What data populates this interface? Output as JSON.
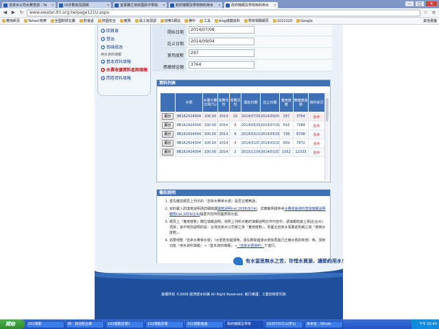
{
  "browser": {
    "tabs": [
      {
        "label": "自來水公司水費查詢 - Ya",
        "active": false
      },
      {
        "label": "ID計數資訊調網",
        "active": false
      },
      {
        "label": "宜賓職立嶺安國民中學綜",
        "active": false
      },
      {
        "label": "欽府端關及學校節約用水",
        "active": false
      },
      {
        "label": "政府機關及學校節約用水",
        "active": true
      }
    ],
    "address": "www.ewater.itri.org.tw/page121U.aspx",
    "bookmarks": [
      "應用新頁",
      "Yahoo!奇摩",
      "全國財研在職",
      "財會處",
      "校園安全",
      "教務",
      "員工資源調",
      "快樂1網站",
      "佛中",
      "工具",
      "blog總體資料",
      "學校相關網頁",
      "1021220",
      "Google"
    ],
    "bookmarks_other": "其他書籤"
  },
  "leftnav": {
    "items": [
      {
        "label": "回首頁",
        "emphasis": false
      },
      {
        "label": "登出",
        "emphasis": false
      },
      {
        "label": "密碼修改",
        "emphasis": false
      }
    ],
    "group_label": "用水資料填報",
    "sub_items": [
      {
        "label": "基本資料填報",
        "emphasis": false
      },
      {
        "label": "水費收據資料查詢填報",
        "emphasis": true
      },
      {
        "label": "問卷資料填報",
        "emphasis": false
      }
    ]
  },
  "form": {
    "rows": [
      {
        "label": "開始日期",
        "value": "2014/07/08"
      },
      {
        "label": "訖止日期",
        "value": "2014/09/04"
      },
      {
        "label": "實用度數",
        "value": "297"
      },
      {
        "label": "應繳總金額",
        "value": "3764"
      }
    ]
  },
  "list": {
    "title": "資料列表",
    "headers": [
      "",
      "水號",
      "水量分攤比例(%)",
      "收費年份",
      "收費月份",
      "開始日期",
      "訖止日期",
      "實用度數",
      "應繳總金額",
      "資料狀況"
    ],
    "button_label": "顯示",
    "rows": [
      {
        "water_no": "8B162424004",
        "ratio": "100.00",
        "year": "2014",
        "month": "10",
        "start": "2014/07/08",
        "end": "2014/09/04",
        "usage": "297",
        "amount": "3764",
        "status": "台水",
        "style": "selected"
      },
      {
        "water_no": "8B162424004",
        "ratio": "100.00",
        "year": "2014",
        "month": "8",
        "start": "2014/05/08",
        "end": "2014/07/08",
        "usage": "616",
        "amount": "7384",
        "status": "台水",
        "style": "odd"
      },
      {
        "water_no": "8B162424004",
        "ratio": "100.00",
        "year": "2014",
        "month": "6",
        "start": "2014/03/10",
        "end": "2014/05/08",
        "usage": "736",
        "amount": "8748",
        "status": "台水",
        "style": "even"
      },
      {
        "water_no": "8B162424004",
        "ratio": "100.00",
        "year": "2014",
        "month": "4",
        "start": "2014/01/07",
        "end": "2014/03/10",
        "usage": "659",
        "amount": "7872",
        "status": "台水",
        "style": "odd"
      },
      {
        "water_no": "8B162424004",
        "ratio": "100.00",
        "year": "2014",
        "month": "2",
        "start": "2013/11/06",
        "end": "2014/01/07",
        "usage": "1052",
        "amount": "12333",
        "status": "台水",
        "style": "even"
      }
    ]
  },
  "notes": {
    "title": "備註說明",
    "items": [
      {
        "text": "首先確認網頁上列示的『自來水費單水號』是否正確無誤。"
      },
      {
        "pre": "資料載入的填寫說明請詳細閱讀",
        "link1": "填寫說明(rel.2008/9/14)",
        "mid": "，詳實載明請參考",
        "link2": "水費收據資料查詢填報說明範例(rel.2009/2/4)",
        "post": "檔案內容所附圖表標示處。"
      },
      {
        "text": "網頁上『實用度數』欄位填報說明，依照上列所示範的填報說明文件內容中，請填報收據上標註(台水)項目，其中特別說明的是：台灣自來水公司單之為『實用度數』，而臺北自來水事業處則稱之為『總用水度數』。"
      },
      {
        "pre": "如要增刪『自來水費單水號』（水號若有錯誤時，請先刪除錯誤水號後再進行正確水號的新增）時，請到功能『用水資料填報』→『基本資料填報』→",
        "link1": "『自來水號資料』",
        "post": "下進行。"
      }
    ]
  },
  "footer": {
    "slogan": "有水當思無水之苦，珍惜水資源，讓節約用水！",
    "copyright": "版權所有 ©2008 經濟部水利署 All Right Reserved. 執行維護：工業技術研究院"
  },
  "taskbar": {
    "start": "開始",
    "tasks": [
      "102環勤",
      "四 - 其他配合推",
      "102環勤評選1",
      "102環勤評選",
      "102環勤會議",
      "政府機關及學校",
      "1020701仁山学山",
      "未命名 - Windo"
    ],
    "clock": "下午 02:40"
  }
}
